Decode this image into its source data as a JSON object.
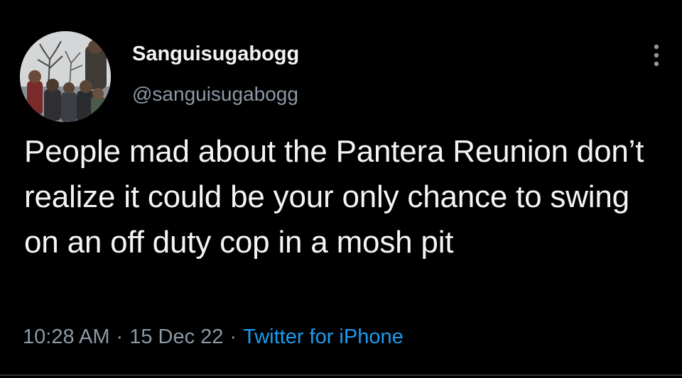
{
  "author": {
    "display_name": "Sanguisugabogg",
    "handle": "@sanguisugabogg",
    "avatar_icon": "group-photo-avatar"
  },
  "tweet": {
    "text": "People mad about the Pantera Reunion don’t realize it could be your only chance to swing on an off duty cop in a mosh pit"
  },
  "meta": {
    "time": "10:28 AM",
    "separator": "·",
    "date": "15 Dec 22",
    "source": "Twitter for iPhone"
  },
  "icons": {
    "more": "more-vertical-icon"
  },
  "colors": {
    "background": "#000000",
    "text": "#e7e9ea",
    "secondary": "#8b98a5",
    "link": "#1d9bf0"
  }
}
